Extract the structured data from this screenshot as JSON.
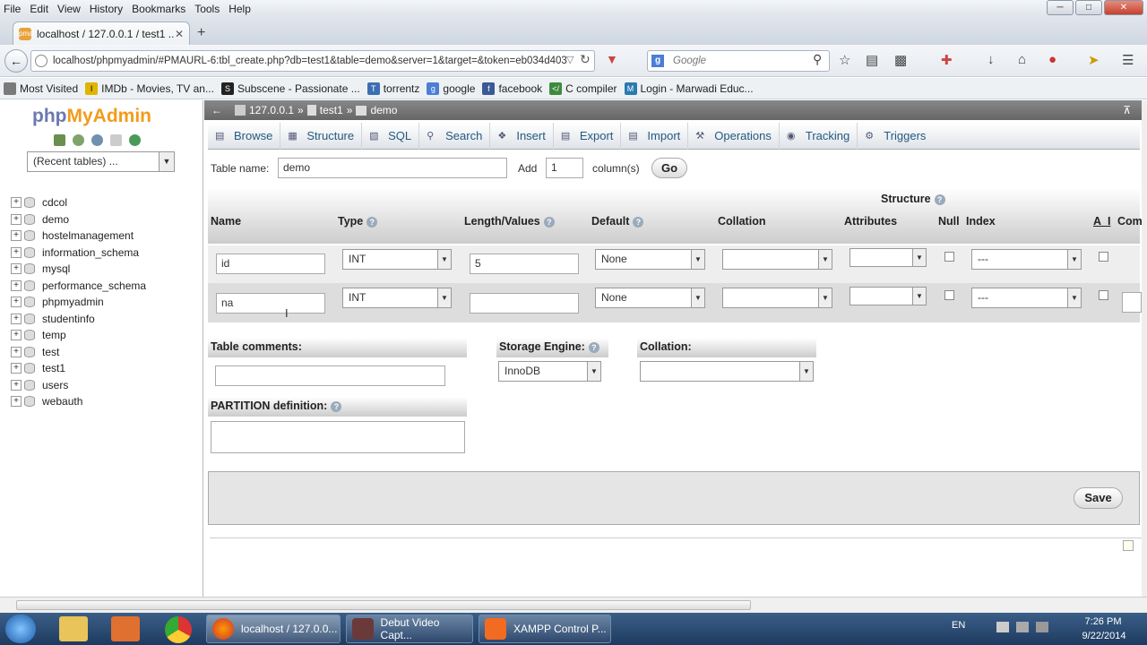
{
  "browser": {
    "menu": [
      "File",
      "Edit",
      "View",
      "History",
      "Bookmarks",
      "Tools",
      "Help"
    ],
    "tab_title": "localhost / 127.0.0.1 / test1 ...",
    "url": "localhost/phpmyadmin/#PMAURL-6:tbl_create.php?db=test1&table=demo&server=1&target=&token=eb034d403",
    "search_placeholder": "Google",
    "bookmarks": [
      "Most Visited",
      "IMDb - Movies, TV an...",
      "Subscene - Passionate ...",
      "torrentz",
      "google",
      "facebook",
      "C compiler",
      "Login - Marwadi Educ..."
    ],
    "bookmark_colors": [
      "#7a7a7a",
      "#e0b400",
      "#222222",
      "#3c6eb4",
      "#4a7fd6",
      "#3b5998",
      "#3d8b3d",
      "#2a7ab0"
    ]
  },
  "sidebar": {
    "logo_php": "php",
    "logo_myadmin": "MyAdmin",
    "recent_tables": "(Recent tables) ...",
    "databases": [
      "cdcol",
      "demo",
      "hostelmanagement",
      "information_schema",
      "mysql",
      "performance_schema",
      "phpmyadmin",
      "studentinfo",
      "temp",
      "test",
      "test1",
      "users",
      "webauth"
    ]
  },
  "breadcrumb": [
    "127.0.0.1",
    "»",
    "test1",
    "»",
    "demo"
  ],
  "tabs": [
    "Browse",
    "Structure",
    "SQL",
    "Search",
    "Insert",
    "Export",
    "Import",
    "Operations",
    "Tracking",
    "Triggers"
  ],
  "form": {
    "table_name_label": "Table name:",
    "table_name": "demo",
    "add_label": "Add",
    "add_count": "1",
    "columns_label": "column(s)",
    "go": "Go",
    "structure_label": "Structure",
    "headers": [
      "Name",
      "Type",
      "Length/Values",
      "Default",
      "Collation",
      "Attributes",
      "Null",
      "Index",
      "A_I",
      "Com"
    ],
    "rows": [
      {
        "name": "id",
        "type": "INT",
        "length": "5",
        "default": "None",
        "collation": "",
        "attributes": "",
        "index": "---"
      },
      {
        "name": "na",
        "type": "INT",
        "length": "",
        "default": "None",
        "collation": "",
        "attributes": "",
        "index": "---"
      }
    ],
    "table_comments_label": "Table comments:",
    "storage_engine_label": "Storage Engine:",
    "storage_engine": "InnoDB",
    "collation_label": "Collation:",
    "partition_label": "PARTITION definition:",
    "save": "Save"
  },
  "taskbar": {
    "items": [
      "localhost / 127.0.0...",
      "Debut Video Capt...",
      "XAMPP Control P..."
    ],
    "lang": "EN",
    "time": "7:26 PM",
    "date": "9/22/2014"
  }
}
